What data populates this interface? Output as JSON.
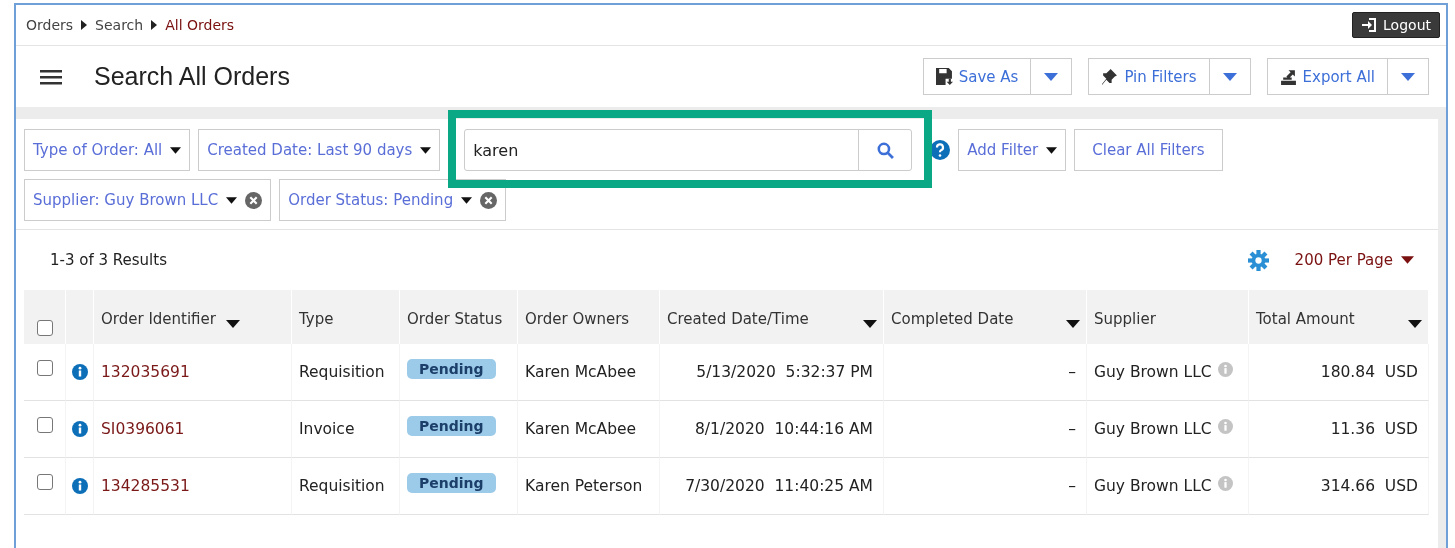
{
  "breadcrumb": [
    {
      "label": "Orders",
      "current": false
    },
    {
      "label": "Search",
      "current": false
    },
    {
      "label": "All Orders",
      "current": true
    }
  ],
  "logout": "Logout",
  "title": "Search All Orders",
  "actions": [
    {
      "label": "Save As",
      "kind": "save"
    },
    {
      "label": "Pin Filters",
      "kind": "pin"
    },
    {
      "label": "Export All",
      "kind": "export"
    }
  ],
  "filters": [
    {
      "label": "Type of Order: All",
      "kind": "dropdown"
    },
    {
      "label": "Created Date: Last 90 days",
      "kind": "dropdown"
    },
    {
      "label": "Supplier: Guy Brown LLC",
      "kind": "removable"
    },
    {
      "label": "Order Status: Pending",
      "kind": "removable"
    }
  ],
  "search": {
    "value": "karen",
    "highlighted": true
  },
  "add_filter": "Add Filter",
  "clear_filters": "Clear All Filters",
  "results": "1-3 of 3 Results",
  "per_page": "200 Per Page",
  "table": {
    "select_all": false,
    "columns": [
      {
        "label": "Order Identifier",
        "sortable": true
      },
      {
        "label": "Type",
        "sortable": false
      },
      {
        "label": "Order Status",
        "sortable": false
      },
      {
        "label": "Order Owners",
        "sortable": false
      },
      {
        "label": "Created Date/Time",
        "sortable": true
      },
      {
        "label": "Completed Date",
        "sortable": true
      },
      {
        "label": "Supplier",
        "sortable": false
      },
      {
        "label": "Total Amount",
        "sortable": true
      }
    ],
    "rows": [
      {
        "checked": false,
        "id": "132035691",
        "type": "Requisition",
        "status": "Pending",
        "owner": "Karen McAbee",
        "created": "5/13/2020  5:32:37 PM",
        "completed": "–",
        "supplier": "Guy Brown LLC",
        "amount": "180.84  USD"
      },
      {
        "checked": false,
        "id": "SI0396061",
        "type": "Invoice",
        "status": "Pending",
        "owner": "Karen McAbee",
        "created": "8/1/2020  10:44:16 AM",
        "completed": "–",
        "supplier": "Guy Brown LLC",
        "amount": "11.36  USD"
      },
      {
        "checked": false,
        "id": "134285531",
        "type": "Requisition",
        "status": "Pending",
        "owner": "Karen Peterson",
        "created": "7/30/2020  11:40:25 AM",
        "completed": "–",
        "supplier": "Guy Brown LLC",
        "amount": "314.66  USD"
      }
    ]
  }
}
